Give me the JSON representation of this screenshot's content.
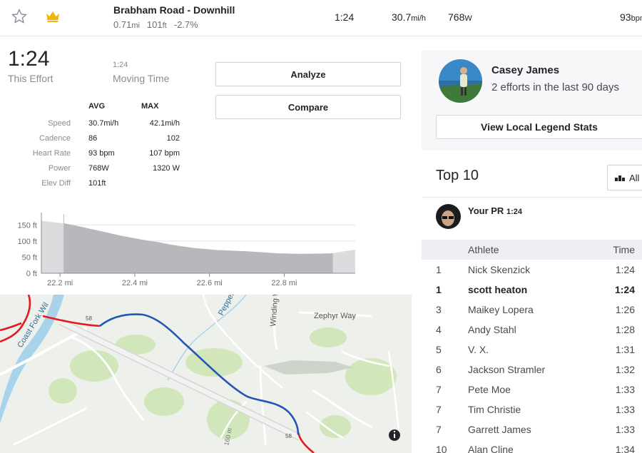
{
  "segment_row": {
    "name": "Brabham Road - Downhill",
    "distance": "0.71",
    "distance_unit": "mi",
    "elevation": "101",
    "elevation_unit": "ft",
    "grade": "-2.7%",
    "time": "1:24",
    "speed": "30.7",
    "speed_unit": "mi/h",
    "power": "768",
    "power_unit": "W",
    "heart_rate": "93",
    "heart_rate_unit": "bpm"
  },
  "effort": {
    "time": "1:24",
    "time_label": "This Effort",
    "moving_time": "1:24",
    "moving_time_label": "Moving Time"
  },
  "buttons": {
    "analyze": "Analyze",
    "compare": "Compare"
  },
  "stats": {
    "avg_header": "AVG",
    "max_header": "MAX",
    "rows": [
      {
        "label": "Speed",
        "avg": "30.7mi/h",
        "max": "42.1mi/h"
      },
      {
        "label": "Cadence",
        "avg": "86",
        "max": "102"
      },
      {
        "label": "Heart Rate",
        "avg": "93 bpm",
        "max": "107 bpm"
      },
      {
        "label": "Power",
        "avg": "768W",
        "max": "1320 W"
      },
      {
        "label": "Elev Diff",
        "avg": "101ft",
        "max": ""
      }
    ]
  },
  "chart_data": {
    "type": "area",
    "title": "",
    "xlabel": "",
    "ylabel": "",
    "x_ticks": [
      "22.2 mi",
      "22.4 mi",
      "22.6 mi",
      "22.8 mi"
    ],
    "y_ticks": [
      "0 ft",
      "50 ft",
      "100 ft",
      "150 ft"
    ],
    "xlim": [
      22.15,
      22.99
    ],
    "ylim": [
      0,
      175
    ],
    "highlight_range": [
      22.21,
      22.93
    ],
    "x": [
      22.15,
      22.17,
      22.19,
      22.21,
      22.25,
      22.28,
      22.32,
      22.36,
      22.42,
      22.46,
      22.5,
      22.56,
      22.62,
      22.7,
      22.78,
      22.84,
      22.9,
      22.93,
      22.96,
      22.99
    ],
    "y": [
      163,
      160,
      157,
      155,
      146,
      138,
      128,
      117,
      104,
      97,
      88,
      78,
      72,
      68,
      62,
      60,
      61,
      62,
      68,
      73
    ],
    "colors": {
      "fill_highlight": "#b8b8bc",
      "fill_outside": "#dcdcdf"
    }
  },
  "map": {
    "labels": {
      "road_58_a": "58",
      "road_58_b": "58",
      "coast_fork": "Coast Fork Wil",
      "pepper": "Pepper",
      "winding": "Winding W",
      "zephyr": "Zephyr Way",
      "elev_line": "160 m"
    },
    "colors": {
      "effort": "#2456b4",
      "route": "#e8191f",
      "water": "#a8d3ea"
    }
  },
  "legend": {
    "name": "Casey James",
    "subtitle": "2 efforts in the last 90 days",
    "button": "View Local Legend Stats"
  },
  "leaderboard": {
    "title": "Top 10",
    "filter": "All",
    "pr_label": "Your PR",
    "pr_time": "1:24",
    "header_athlete": "Athlete",
    "header_time": "Time",
    "rows": [
      {
        "rank": "1",
        "name": "Nick Skenzick",
        "time": "1:24"
      },
      {
        "rank": "1",
        "name": "scott heaton",
        "time": "1:24"
      },
      {
        "rank": "3",
        "name": "Maikey Lopera",
        "time": "1:26"
      },
      {
        "rank": "4",
        "name": "Andy Stahl",
        "time": "1:28"
      },
      {
        "rank": "5",
        "name": "V. X.",
        "time": "1:31"
      },
      {
        "rank": "6",
        "name": "Jackson Stramler",
        "time": "1:32"
      },
      {
        "rank": "7",
        "name": "Pete Moe",
        "time": "1:33"
      },
      {
        "rank": "7",
        "name": "Tim Christie",
        "time": "1:33"
      },
      {
        "rank": "7",
        "name": "Garrett James",
        "time": "1:33"
      },
      {
        "rank": "10",
        "name": "Alan Cline",
        "time": "1:34"
      }
    ]
  },
  "colors": {
    "accent": "#fc4c02",
    "crown": "#f2b705"
  }
}
